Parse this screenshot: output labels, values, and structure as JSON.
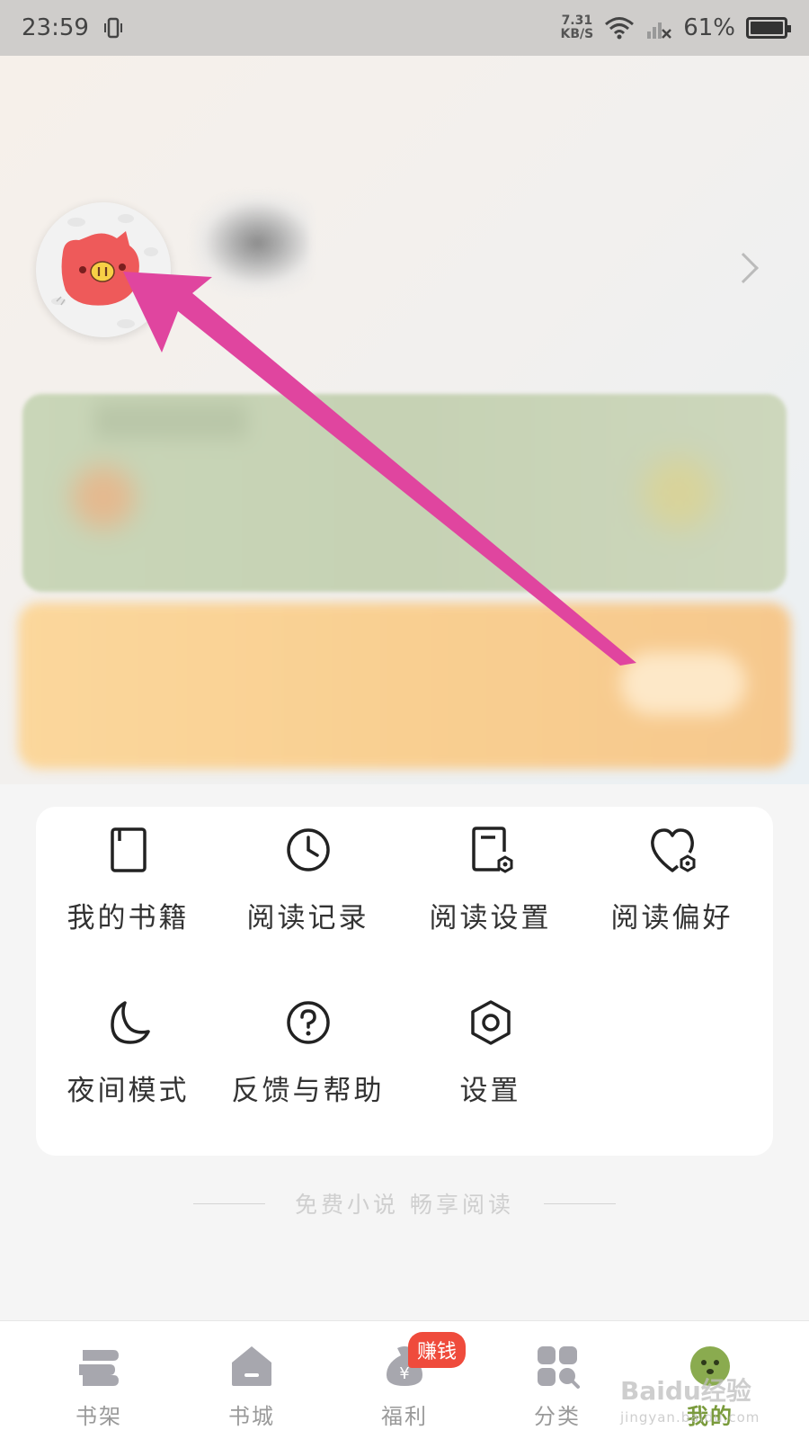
{
  "status_bar": {
    "time": "23:59",
    "net_speed_value": "7.31",
    "net_speed_unit": "KB/S",
    "battery": "61%"
  },
  "profile": {
    "avatar_icon": "pig-avatar-icon",
    "chevron_icon": "chevron-right-icon"
  },
  "menu": {
    "items": [
      {
        "label": "我的书籍",
        "icon": "book-icon"
      },
      {
        "label": "阅读记录",
        "icon": "clock-icon"
      },
      {
        "label": "阅读设置",
        "icon": "document-settings-icon"
      },
      {
        "label": "阅读偏好",
        "icon": "heart-settings-icon"
      },
      {
        "label": "夜间模式",
        "icon": "moon-icon"
      },
      {
        "label": "反馈与帮助",
        "icon": "question-icon"
      },
      {
        "label": "设置",
        "icon": "hexagon-settings-icon"
      }
    ]
  },
  "tagline": "免费小说 畅享阅读",
  "bottom_nav": {
    "items": [
      {
        "label": "书架",
        "icon": "bookshelf-icon"
      },
      {
        "label": "书城",
        "icon": "bookstore-icon"
      },
      {
        "label": "福利",
        "icon": "money-bag-icon",
        "badge": "赚钱"
      },
      {
        "label": "分类",
        "icon": "category-grid-icon"
      },
      {
        "label": "我的",
        "icon": "profile-icon",
        "active": true
      }
    ]
  },
  "watermark": {
    "brand": "Baidu经验",
    "url": "jingyan.baidu.com"
  },
  "colors": {
    "accent_active": "#7a9b3c",
    "badge": "#ef4b3c",
    "annotation_arrow": "#e0459f"
  }
}
